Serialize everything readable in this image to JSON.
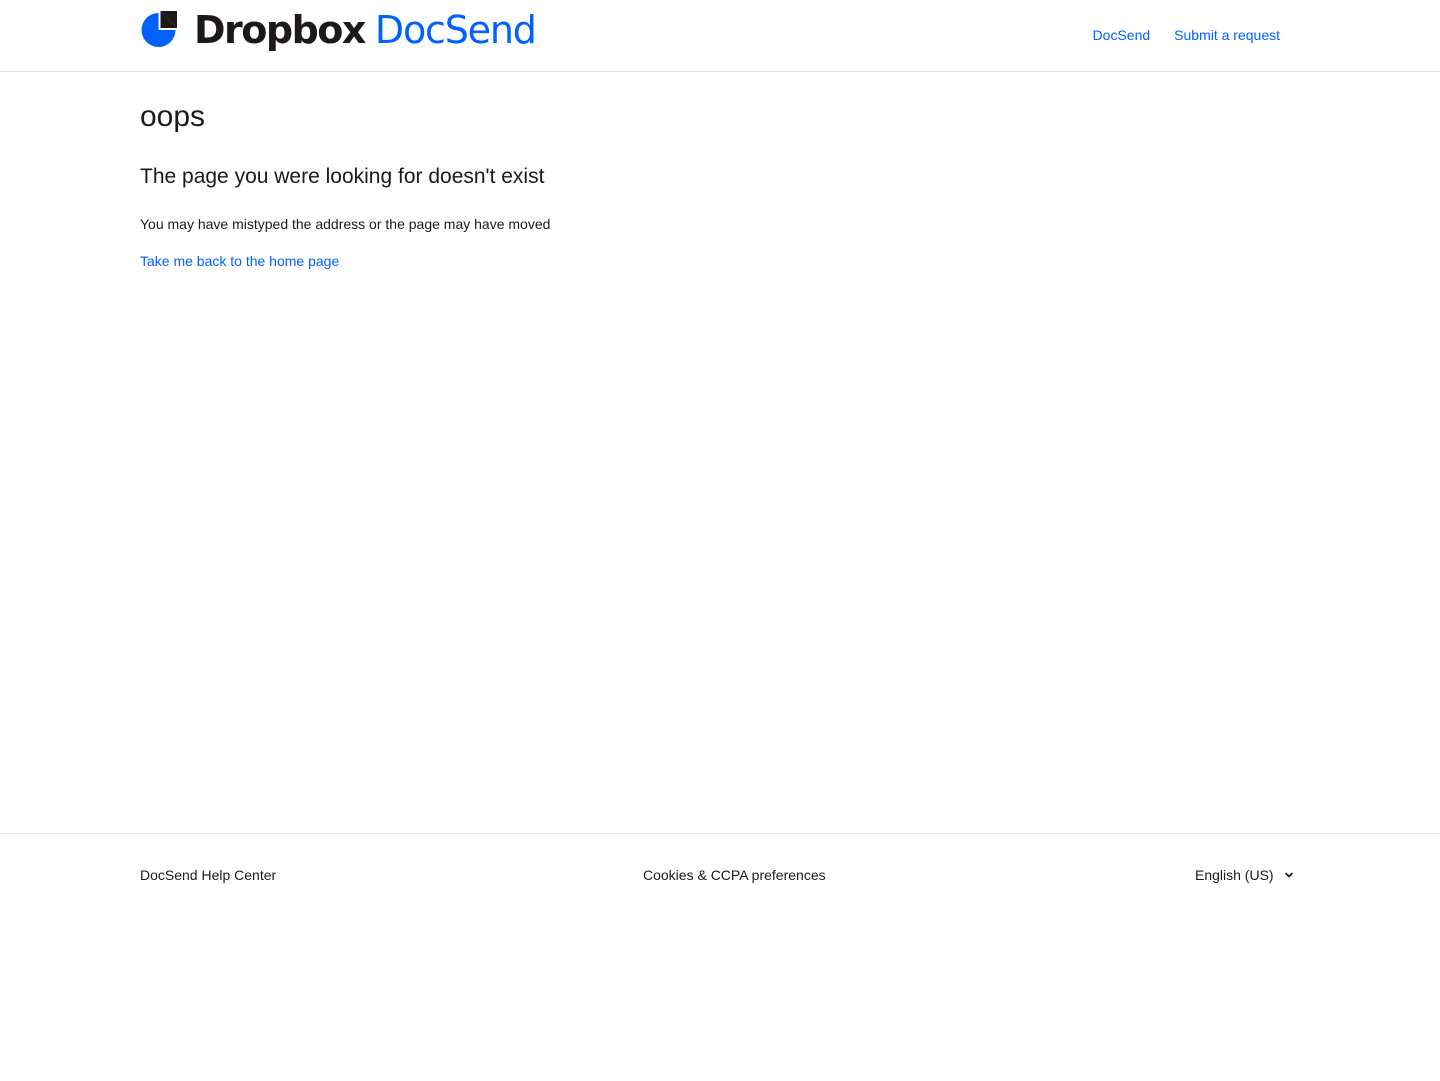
{
  "header": {
    "logo": {
      "word_primary": "Dropbox",
      "word_secondary": "DocSend",
      "icon": "dropbox-docsend-logo-icon"
    },
    "nav": [
      {
        "label": "DocSend"
      },
      {
        "label": "Submit a request"
      }
    ]
  },
  "main": {
    "title": "oops",
    "subtitle": "The page you were looking for doesn't exist",
    "description": "You may have mistyped the address or the page may have moved",
    "home_link": "Take me back to the home page"
  },
  "footer": {
    "help_center": "DocSend Help Center",
    "cookies": "Cookies & CCPA preferences",
    "language": {
      "selected": "English (US)",
      "icon": "chevron-down-icon"
    }
  },
  "colors": {
    "accent": "#0061fe",
    "text": "#1e1919",
    "divider": "#e0e0e0",
    "background": "#ffffff"
  }
}
